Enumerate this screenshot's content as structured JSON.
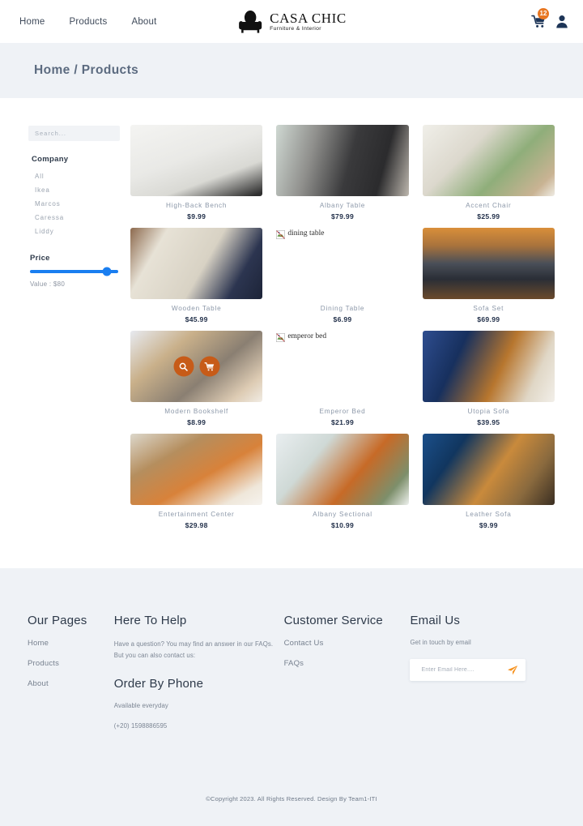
{
  "header": {
    "nav": [
      {
        "label": "Home"
      },
      {
        "label": "Products"
      },
      {
        "label": "About"
      }
    ],
    "brand": {
      "name": "CASA CHIC",
      "tagline": "Furniture & Interior",
      "logo_icon": "armchair-icon"
    },
    "cart": {
      "icon": "shopping-cart-icon",
      "badge_count": "12"
    },
    "account": {
      "icon": "user-icon"
    }
  },
  "breadcrumb": {
    "text": "Home / Products"
  },
  "sidebar": {
    "search": {
      "placeholder": "Search...",
      "value": ""
    },
    "company": {
      "title": "Company",
      "options": [
        {
          "label": "All"
        },
        {
          "label": "Ikea"
        },
        {
          "label": "Marcos"
        },
        {
          "label": "Caressa"
        },
        {
          "label": "Liddy"
        }
      ]
    },
    "price": {
      "title": "Price",
      "value_label": "Value : $80",
      "slider_percent": 87
    }
  },
  "products": [
    {
      "title": "High-Back Bench",
      "price": "$9.99",
      "image_state": "loaded",
      "image_alt": "high-back bench",
      "hover_actions": false
    },
    {
      "title": "Albany Table",
      "price": "$79.99",
      "image_state": "loaded",
      "image_alt": "albany table",
      "hover_actions": false
    },
    {
      "title": "Accent Chair",
      "price": "$25.99",
      "image_state": "loaded",
      "image_alt": "accent chair",
      "hover_actions": false
    },
    {
      "title": "Wooden Table",
      "price": "$45.99",
      "image_state": "loaded",
      "image_alt": "wooden table",
      "hover_actions": false
    },
    {
      "title": "Dining Table",
      "price": "$6.99",
      "image_state": "broken",
      "image_alt": "dining table",
      "hover_actions": false
    },
    {
      "title": "Sofa Set",
      "price": "$69.99",
      "image_state": "loaded",
      "image_alt": "sofa set",
      "hover_actions": false
    },
    {
      "title": "Modern Bookshelf",
      "price": "$8.99",
      "image_state": "loaded",
      "image_alt": "modern bookshelf",
      "hover_actions": true
    },
    {
      "title": "Emperor Bed",
      "price": "$21.99",
      "image_state": "broken",
      "image_alt": "emperor bed",
      "hover_actions": false
    },
    {
      "title": "Utopia Sofa",
      "price": "$39.95",
      "image_state": "loaded",
      "image_alt": "utopia sofa",
      "hover_actions": false
    },
    {
      "title": "Entertainment Center",
      "price": "$29.98",
      "image_state": "loaded",
      "image_alt": "entertainment center",
      "hover_actions": false
    },
    {
      "title": "Albany Sectional",
      "price": "$10.99",
      "image_state": "loaded",
      "image_alt": "albany sectional",
      "hover_actions": false
    },
    {
      "title": "Leather Sofa",
      "price": "$9.99",
      "image_state": "loaded",
      "image_alt": "leather sofa",
      "hover_actions": false
    }
  ],
  "card_actions": {
    "quick_view_icon": "search-icon",
    "add_to_cart_icon": "shopping-cart-icon"
  },
  "footer": {
    "pages": {
      "title": "Our Pages",
      "links": [
        {
          "label": "Home"
        },
        {
          "label": "Products"
        },
        {
          "label": "About"
        }
      ]
    },
    "help": {
      "title": "Here To Help",
      "body": "Have a question? You may find an answer in our FAQs. But you can also contact us:",
      "phone_title": "Order By Phone",
      "availability": "Available everyday",
      "phone": "(+20) 1598886595"
    },
    "service": {
      "title": "Customer Service",
      "links": [
        {
          "label": "Contact Us"
        },
        {
          "label": "FAQs"
        }
      ]
    },
    "email": {
      "title": "Email Us",
      "subtitle": "Get in touch by email",
      "placeholder": "Enter Email Here....",
      "value": "",
      "send_icon": "paper-plane-icon"
    },
    "copyright": "©Copyright 2023. All Rights Reserved. Design By Team1-ITI"
  },
  "colors": {
    "accent_orange": "#e87722",
    "action_orange": "#c75b18",
    "slider_blue": "#1a7ef0",
    "band_bg": "#eff2f6",
    "text_dark": "#2e3a4a",
    "text_muted": "#8b97a8"
  }
}
